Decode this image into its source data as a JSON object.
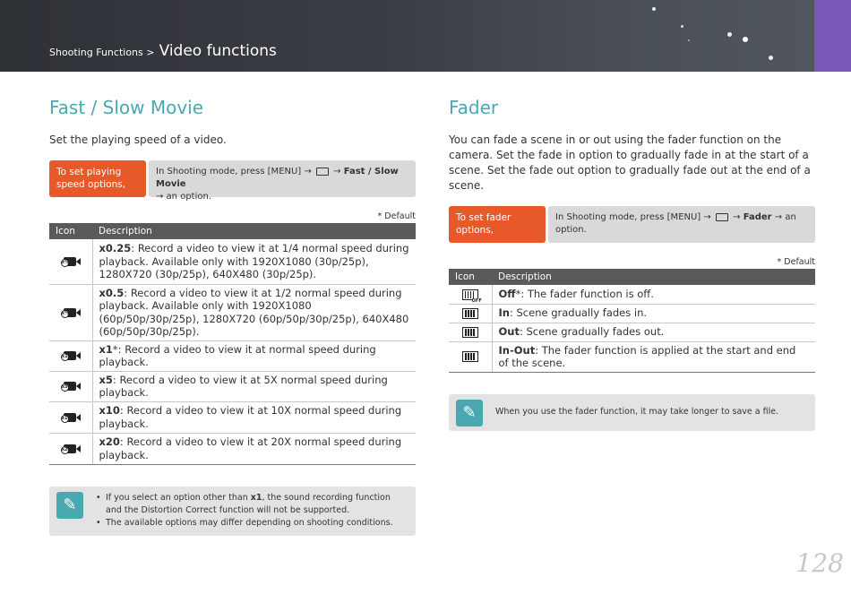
{
  "header": {
    "breadcrumb_parent": "Shooting Functions >",
    "breadcrumb_current": "Video functions"
  },
  "left": {
    "title": "Fast / Slow Movie",
    "intro": "Set the playing speed of a video.",
    "instr_label": "To set playing speed options,",
    "instr_prefix": "In Shooting mode, press [MENU] →",
    "instr_arrow": "→",
    "instr_target": "Fast / Slow Movie",
    "instr_suffix": "→ an option.",
    "default_note": "* Default",
    "table_headers": [
      "Icon",
      "Description"
    ],
    "rows": [
      {
        "icon": "speed-x0.25-icon",
        "badge": "x¼",
        "term": "x0.25",
        "desc": ": Record a video to view it at 1/4 normal speed during playback. Available only with 1920X1080 (30p/25p), 1280X720 (30p/25p), 640X480 (30p/25p)."
      },
      {
        "icon": "speed-x0.5-icon",
        "badge": "x½",
        "term": "x0.5",
        "desc": ": Record a video to view it at 1/2 normal speed during playback. Available only with 1920X1080 (60p/50p/30p/25p), 1280X720 (60p/50p/30p/25p), 640X480 (60p/50p/30p/25p)."
      },
      {
        "icon": "speed-x1-icon",
        "badge": "x1",
        "term": "x1",
        "desc": "*: Record a video to view it at normal speed during playback."
      },
      {
        "icon": "speed-x5-icon",
        "badge": "x5",
        "term": "x5",
        "desc": ": Record a video to view it at 5X normal speed during playback."
      },
      {
        "icon": "speed-x10-icon",
        "badge": "x10",
        "term": "x10",
        "desc": ": Record a video to view it at 10X normal speed during playback."
      },
      {
        "icon": "speed-x20-icon",
        "badge": "x20",
        "term": "x20",
        "desc": ": Record a video to view it at 20X normal speed during playback."
      }
    ],
    "note_line1_pre": "If you select an option other than ",
    "note_line1_bold": "x1",
    "note_line1_post": ", the sound recording function and the Distortion Correct function will not be supported.",
    "note_line2": "The available options may differ depending on shooting conditions."
  },
  "right": {
    "title": "Fader",
    "intro": "You can fade a scene in or out using the fader function on the camera. Set the fade in option to gradually fade in at the start of a scene. Set the fade out option to gradually fade out at the end of a scene.",
    "instr_label": "To set fader options,",
    "instr_prefix": "In Shooting mode, press [MENU] →",
    "instr_arrow": "→",
    "instr_target": "Fader",
    "instr_suffix": "→ an option.",
    "default_note": "* Default",
    "table_headers": [
      "Icon",
      "Description"
    ],
    "rows": [
      {
        "icon": "fader-off-icon",
        "badge": "OFF",
        "term": "Off",
        "desc": "*: The fader function is off."
      },
      {
        "icon": "fader-in-icon",
        "badge": "",
        "term": "In",
        "desc": ": Scene gradually fades in."
      },
      {
        "icon": "fader-out-icon",
        "badge": "",
        "term": "Out",
        "desc": ": Scene gradually fades out."
      },
      {
        "icon": "fader-in-out-icon",
        "badge": "",
        "term": "In-Out",
        "desc": ": The fader function is applied at the start and end of the scene."
      }
    ],
    "note": "When you use the fader function, it may take longer to save a file."
  },
  "page_number": "128"
}
